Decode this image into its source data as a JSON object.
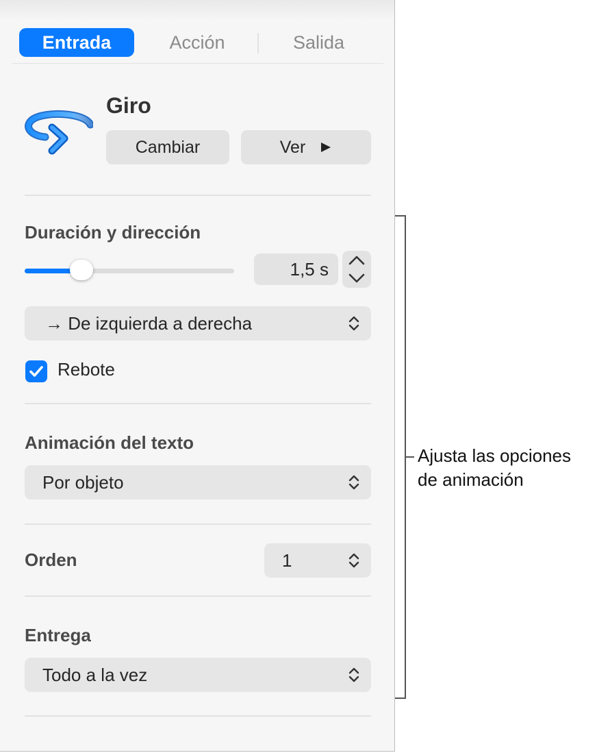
{
  "tabs": [
    {
      "label": "Entrada",
      "active": true
    },
    {
      "label": "Acción",
      "active": false
    },
    {
      "label": "Salida",
      "active": false
    }
  ],
  "effect": {
    "name": "Giro",
    "icon": "spin-arrow-icon",
    "change_label": "Cambiar",
    "preview_label": "Ver"
  },
  "duration": {
    "section_label": "Duración y dirección",
    "value_text": "1,5 s",
    "slider_fraction": 0.27,
    "direction_text": "→ De izquierda a derecha"
  },
  "bounce": {
    "label": "Rebote",
    "checked": true
  },
  "text_animation": {
    "section_label": "Animación del texto",
    "value": "Por objeto"
  },
  "order": {
    "label": "Orden",
    "value": "1"
  },
  "delivery": {
    "section_label": "Entrega",
    "value": "Todo a la vez"
  },
  "callout": {
    "line1": "Ajusta las opciones",
    "line2": "de animación"
  },
  "colors": {
    "accent": "#0a7aff",
    "panel_bg": "#f6f6f6",
    "control_bg": "#e3e3e3"
  }
}
